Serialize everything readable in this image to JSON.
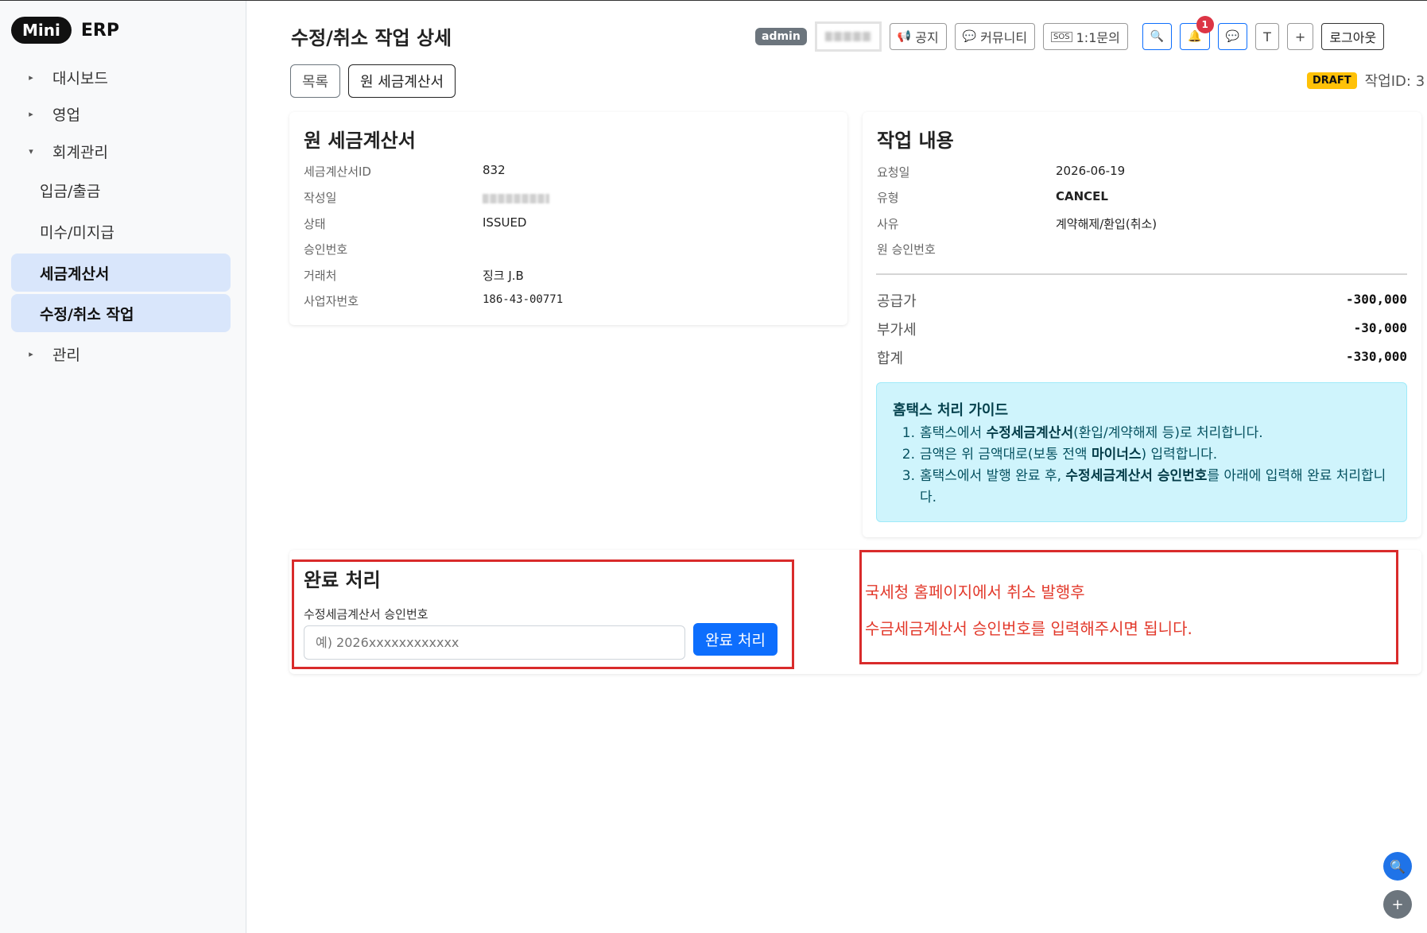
{
  "brand": {
    "pill": "Mini",
    "text": "ERP"
  },
  "sidebar": {
    "items": [
      {
        "label": "대시보드",
        "caret": "▸"
      },
      {
        "label": "영업",
        "caret": "▸"
      },
      {
        "label": "회계관리",
        "caret": "▾"
      },
      {
        "label": "입금/출금"
      },
      {
        "label": "미수/미지급"
      },
      {
        "label": "세금계산서"
      },
      {
        "label": "수정/취소 작업"
      },
      {
        "label": "관리",
        "caret": "▸"
      }
    ]
  },
  "header": {
    "title": "수정/취소 작업 상세",
    "admin_badge": "admin",
    "notice": "공지",
    "community": "커뮤니티",
    "inquiry": "1:1문의",
    "notif_count": "1",
    "t_btn": "T",
    "plus_btn": "+",
    "logout": "로그아웃"
  },
  "actions": {
    "list": "목록",
    "original_invoice": "원 세금계산서"
  },
  "status": {
    "draft": "DRAFT",
    "job_id": "작업ID: 3"
  },
  "original_card": {
    "title": "원 세금계산서",
    "rows": [
      {
        "label": "세금계산서ID",
        "value": "832"
      },
      {
        "label": "작성일",
        "value": ""
      },
      {
        "label": "상태",
        "value": "ISSUED"
      },
      {
        "label": "승인번호",
        "value": ""
      },
      {
        "label": "거래처",
        "value": "징크 J.B"
      },
      {
        "label": "사업자번호",
        "value": "186-43-00771"
      }
    ]
  },
  "job_card": {
    "title": "작업 내용",
    "rows": [
      {
        "label": "요청일",
        "value": "2026-06-19"
      },
      {
        "label": "유형",
        "value": "CANCEL"
      },
      {
        "label": "사유",
        "value": "계약해제/환입(취소)"
      },
      {
        "label": "원 승인번호",
        "value": ""
      }
    ],
    "amounts": [
      {
        "label": "공급가",
        "value": "-300,000"
      },
      {
        "label": "부가세",
        "value": "-30,000"
      },
      {
        "label": "합계",
        "value": "-330,000"
      }
    ]
  },
  "guide": {
    "title": "홈택스 처리 가이드",
    "items": [
      {
        "num": "1.",
        "a": "홈택스에서 ",
        "b": "수정세금계산서",
        "c": "(환입/계약해제 등)로 처리합니다."
      },
      {
        "num": "2.",
        "a": "금액은 위 금액대로(보통 전액 ",
        "b": "마이너스",
        "c": ") 입력합니다."
      },
      {
        "num": "3.",
        "a": "홈택스에서 발행 완료 후, ",
        "b": "수정세금계산서 승인번호",
        "c": "를 아래에 입력해 완료 처리합니다."
      }
    ]
  },
  "complete": {
    "title": "완료 처리",
    "field_label": "수정세금계산서 승인번호",
    "placeholder": "예) 2026xxxxxxxxxxxx",
    "button": "완료 처리"
  },
  "annotation": {
    "line1": "국세청 홈페이지에서 취소 발행후",
    "line2": "수금세금계산서 승인번호를 입력해주시면 됩니다."
  },
  "colors": {
    "primary": "#0d6efd",
    "annotation_red": "#d92b2b",
    "draft": "#ffc107",
    "guide_bg": "#cff4fc"
  }
}
